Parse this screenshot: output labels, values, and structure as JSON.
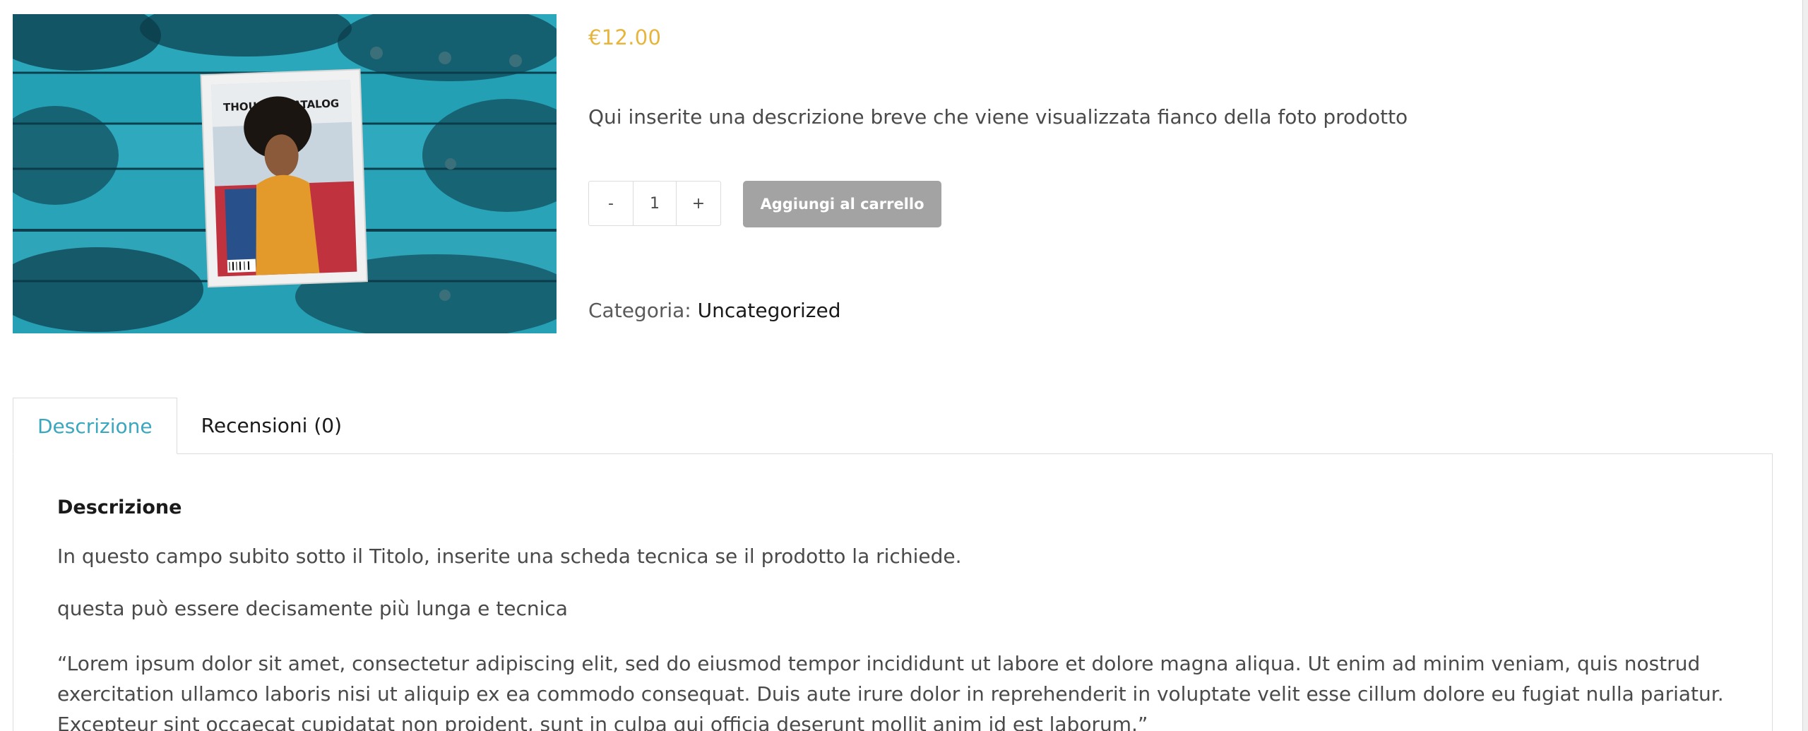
{
  "product": {
    "image_alt": "Thought Catalog magazine on blue wooden surface",
    "magazine_title": "THOUGHT CATALOG",
    "price": "€12.00",
    "short_description": "Qui inserite una descrizione breve che viene visualizzata fianco della foto prodotto",
    "quantity": {
      "minus_label": "-",
      "value": "1",
      "plus_label": "+"
    },
    "add_to_cart_label": "Aggiungi al carrello",
    "category_label": "Categoria:",
    "category_value": "Uncategorized"
  },
  "tabs": [
    {
      "label": "Descrizione",
      "active": true
    },
    {
      "label": "Recensioni (0)",
      "active": false
    }
  ],
  "panel": {
    "heading": "Descrizione",
    "paragraph_1": "In questo campo subito sotto il Titolo, inserite una scheda tecnica se il prodotto la richiede.",
    "paragraph_2": "questa può essere decisamente più lunga e tecnica",
    "paragraph_3": "“Lorem ipsum dolor sit amet, consectetur adipiscing elit, sed do eiusmod tempor incididunt ut labore et dolore magna aliqua. Ut enim ad minim veniam, quis nostrud exercitation ullamco laboris nisi ut aliquip ex ea commodo consequat. Duis aute irure dolor in reprehenderit in voluptate velit esse cillum dolore eu fugiat nulla pariatur. Excepteur sint occaecat cupidatat non proident, sunt in culpa qui officia deserunt mollit anim id est laborum.”"
  },
  "colors": {
    "price": "#e8b53c",
    "tab_active": "#3aa7bf",
    "button_bg": "#a3a3a3",
    "border": "#dcdcdc"
  }
}
